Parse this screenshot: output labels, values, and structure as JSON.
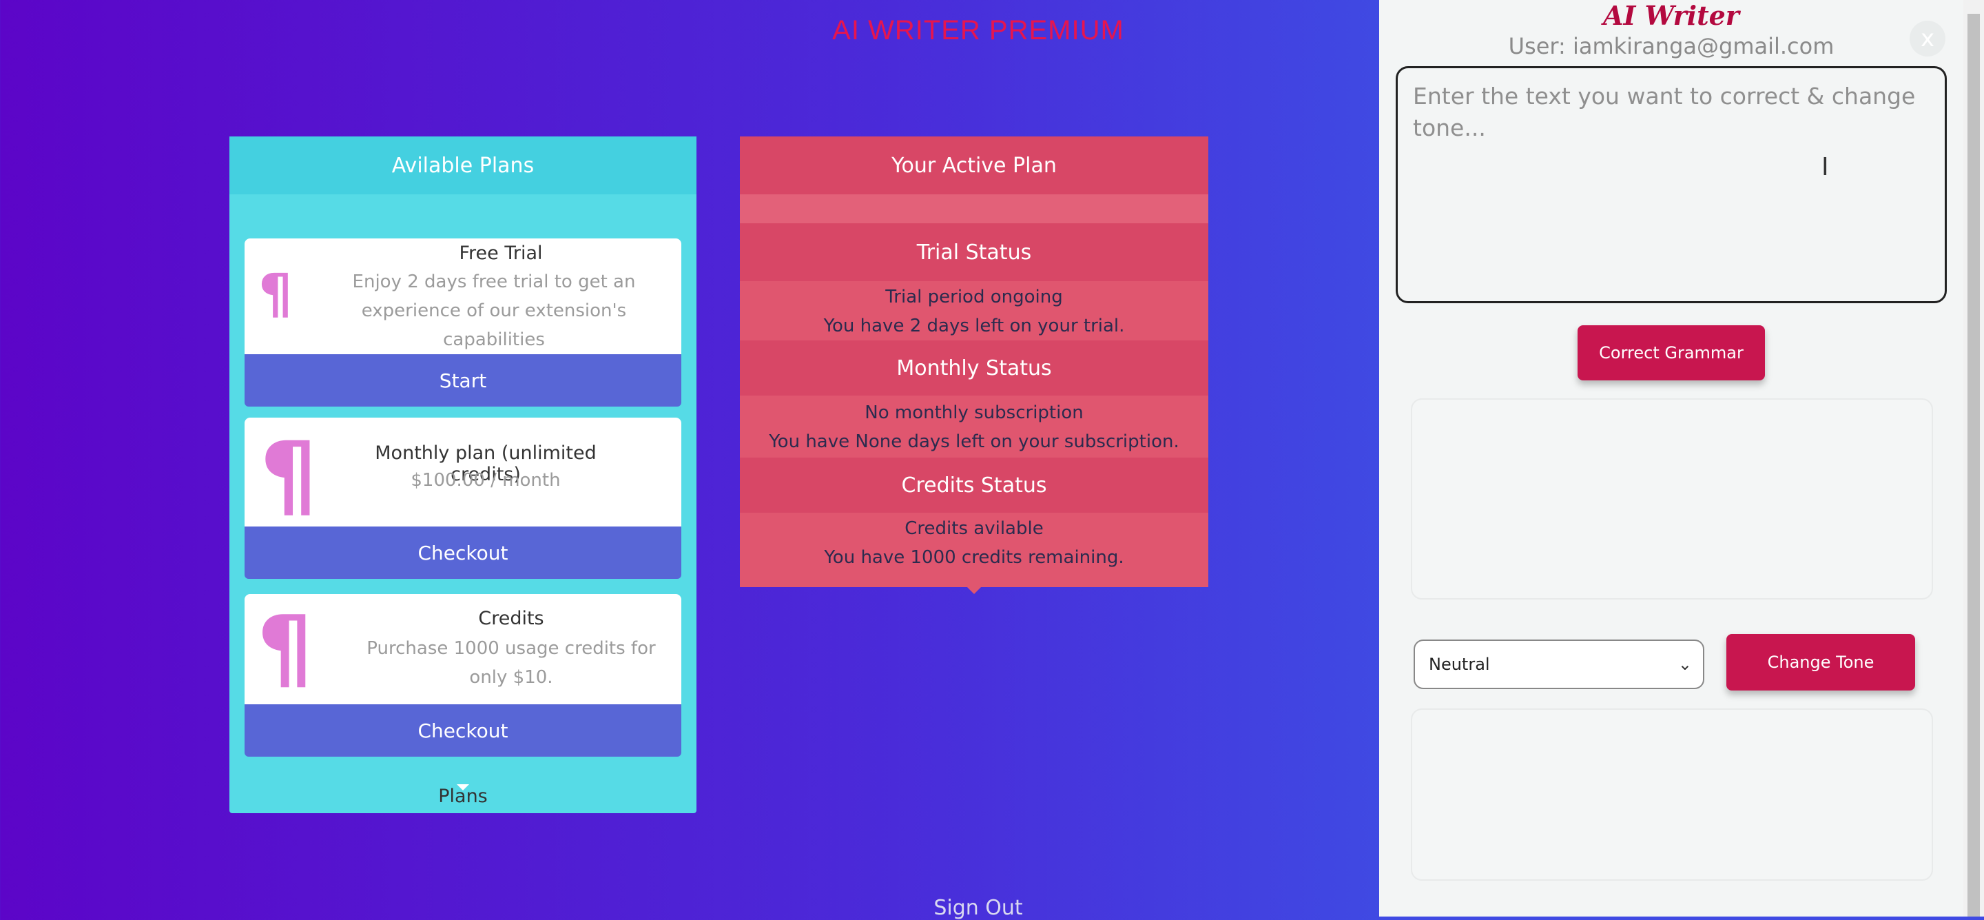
{
  "app": {
    "title": "AI WRITER PREMIUM",
    "sign_out": "Sign Out"
  },
  "plans": {
    "header": "Avilable Plans",
    "footer": "Plans",
    "items": [
      {
        "title": "Free Trial",
        "desc": "Enjoy 2 days free trial to get an experience of our extension's capabilities",
        "button": "Start",
        "icon": "pilcrow-icon"
      },
      {
        "title": "Monthly plan (unlimited credits)",
        "desc": "$100.00 / month",
        "button": "Checkout",
        "icon": "pilcrow-icon"
      },
      {
        "title": "Credits",
        "desc": "Purchase 1000 usage credits for only $10.",
        "button": "Checkout",
        "icon": "pilcrow-icon"
      }
    ]
  },
  "active_plan": {
    "header": "Your Active Plan",
    "trial": {
      "title": "Trial Status",
      "line1": "Trial period ongoing",
      "line2": "You have 2 days left on your trial."
    },
    "monthly": {
      "title": "Monthly Status",
      "line1": "No monthly subscription",
      "line2": "You have None days left on your subscription."
    },
    "credits": {
      "title": "Credits Status",
      "line1": "Credits avilable",
      "line2": "You have 1000 credits remaining."
    }
  },
  "side_panel": {
    "brand": "AI Writer",
    "user": "User: iamkiranga@gmail.com",
    "close": "x",
    "input_placeholder": "Enter the text you want to correct & change tone...",
    "correct_button": "Correct Grammar",
    "tone_selected": "Neutral",
    "change_tone_button": "Change Tone"
  },
  "colors": {
    "accent": "#c8164f",
    "plans_bg": "#56dbe6",
    "active_bg": "#e0566f",
    "button_blue": "#5866d6"
  }
}
